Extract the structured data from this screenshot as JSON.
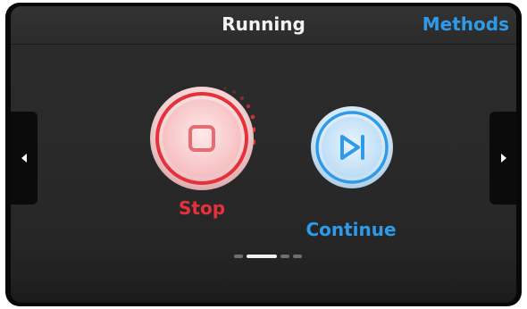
{
  "header": {
    "title": "Running",
    "methods_label": "Methods"
  },
  "actions": {
    "stop_label": "Stop",
    "continue_label": "Continue"
  },
  "pager": {
    "page_count": 4,
    "active_index": 1
  },
  "colors": {
    "stop_red": "#e8303a",
    "continue_blue": "#2e9bea",
    "title_text": "#f2f2f2"
  },
  "icons": {
    "nav_left": "chevron-left-icon",
    "nav_right": "chevron-right-icon",
    "stop": "stop-square-icon",
    "continue": "skip-forward-icon"
  }
}
